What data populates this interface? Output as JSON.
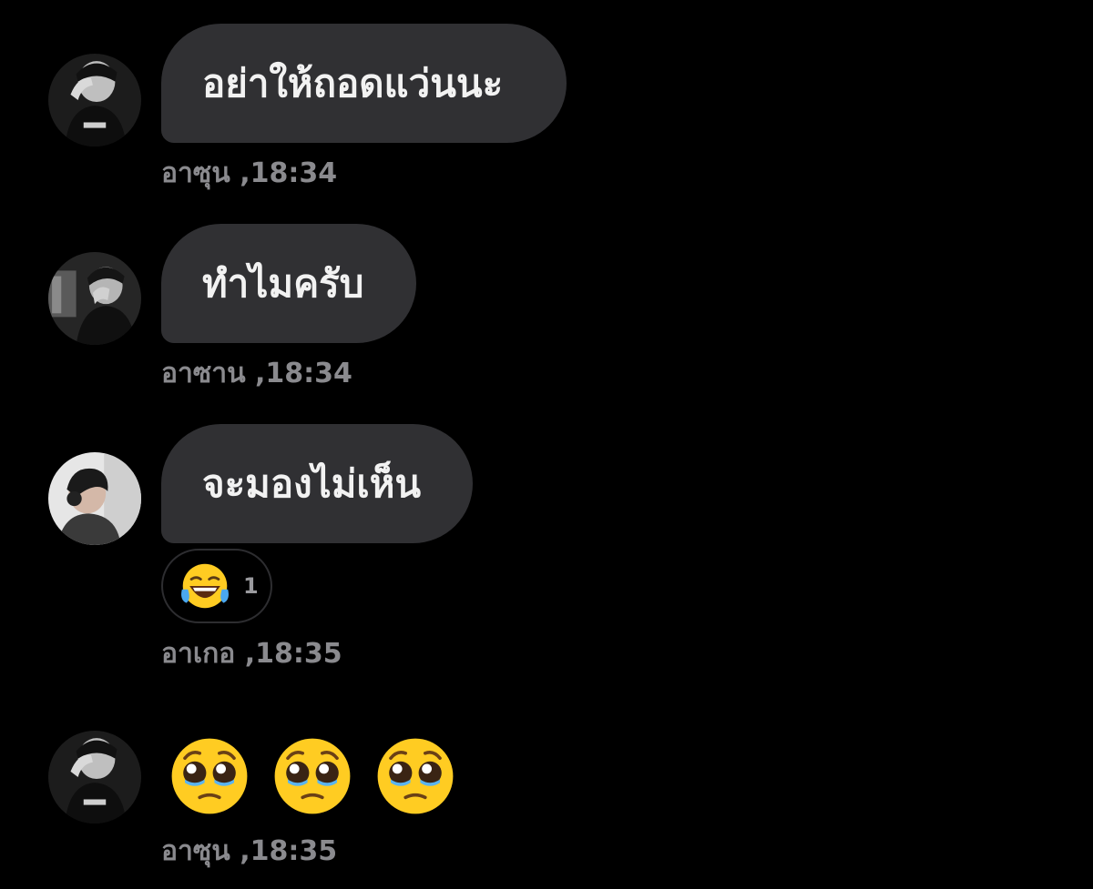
{
  "messages": [
    {
      "sender": "อาซุน",
      "time": ",18:34",
      "text": "อย่าให้ถอดแว่นนะ"
    },
    {
      "sender": "อาซาน",
      "time": ",18:34",
      "text": "ทำไมครับ"
    },
    {
      "sender": "อาเกอ",
      "time": ",18:35",
      "text": "จะมองไม่เห็น",
      "reaction": {
        "icon": "laughing-tears-emoji",
        "count": "1"
      }
    },
    {
      "sender": "อาซุน",
      "time": ",18:35",
      "emojis": [
        "pleading-face-emoji",
        "pleading-face-emoji",
        "pleading-face-emoji"
      ]
    }
  ],
  "colors": {
    "background": "#000000",
    "bubble": "#303033",
    "bubble_text": "#f2f2f2",
    "meta_text": "#8a8a8e",
    "emoji_yellow": "#ffcc22"
  }
}
